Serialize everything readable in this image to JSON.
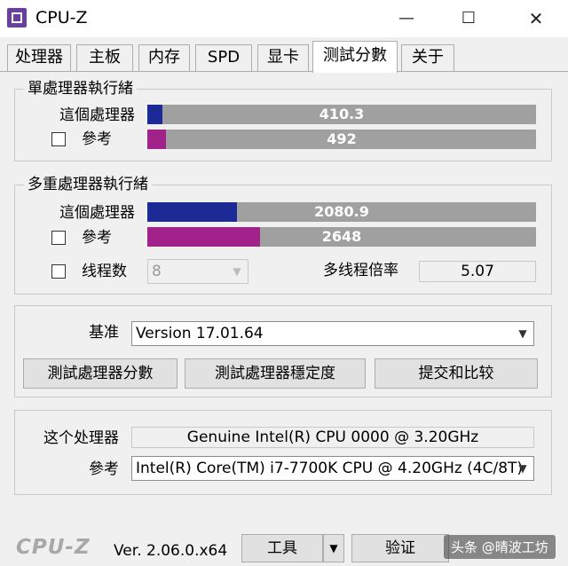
{
  "window": {
    "title": "CPU-Z"
  },
  "tabs": [
    {
      "label": "处理器"
    },
    {
      "label": "主板"
    },
    {
      "label": "内存"
    },
    {
      "label": "SPD"
    },
    {
      "label": "显卡"
    },
    {
      "label": "测試分數",
      "active": true
    },
    {
      "label": "关于"
    }
  ],
  "single_thread": {
    "title": "單處理器執行緒",
    "this_label": "這個處理器",
    "this_value": "410.3",
    "this_fraction": 0.039,
    "ref_label": "參考",
    "ref_value": "492",
    "ref_fraction": 0.047
  },
  "multi_thread": {
    "title": "多重處理器執行緒",
    "this_label": "這個處理器",
    "this_value": "2080.9",
    "this_fraction": 0.23,
    "ref_label": "參考",
    "ref_value": "2648",
    "ref_fraction": 0.29,
    "threads_label": "线程数",
    "threads_value": "8",
    "ratio_label": "多线程倍率",
    "ratio_value": "5.07"
  },
  "benchmark": {
    "label": "基准",
    "version": "Version 17.01.64",
    "btn_bench": "測試處理器分數",
    "btn_stress": "測試處理器穩定度",
    "btn_submit": "提交和比较"
  },
  "cpu_info": {
    "this_label": "这个处理器",
    "this_value": "Genuine Intel(R) CPU 0000 @ 3.20GHz",
    "ref_label": "參考",
    "ref_value": "Intel(R) Core(TM) i7-7700K CPU @ 4.20GHz (4C/8T)"
  },
  "footer": {
    "logo": "CPU-Z",
    "version": "Ver. 2.06.0.x64",
    "tools_label": "工具",
    "validate_label": "验证",
    "watermark": "头条 @晴波工坊"
  },
  "colors": {
    "this_fill": "#1c2a96",
    "ref_fill": "#a2228c",
    "bar_bg": "#a0a0a0"
  }
}
